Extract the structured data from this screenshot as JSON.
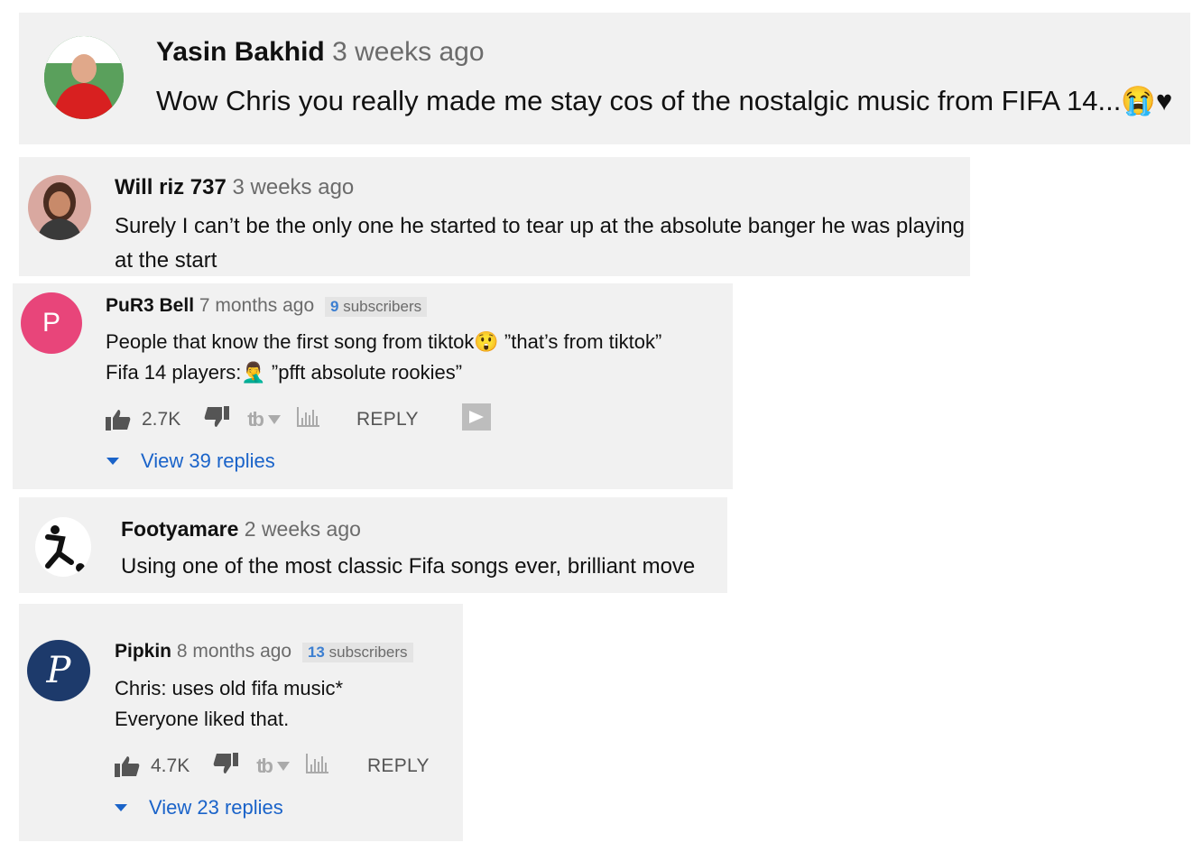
{
  "comments": [
    {
      "author": "Yasin Bakhid",
      "time": "3 weeks ago",
      "lines": [
        "Wow Chris you really made me stay cos of the nostalgic music from FIFA 14...😭♥"
      ]
    },
    {
      "author": "Will riz 737",
      "time": "3 weeks ago",
      "lines": [
        "Surely I can’t be the only one he started to tear up at the absolute banger he was playing",
        "at the start"
      ]
    },
    {
      "author": "PuR3 Bell",
      "time": "7 months ago",
      "subs_count": "9",
      "subs_label": "subscribers",
      "avatar_letter": "P",
      "lines": [
        "People that know the first song from tiktok😲 ”that’s from tiktok”",
        "Fifa 14 players:🤦‍♂️ ”pfft absolute rookies”"
      ],
      "likes": "2.7K",
      "reply_label": "REPLY",
      "view_replies": "View 39 replies"
    },
    {
      "author": "Footyamare",
      "time": "2 weeks ago",
      "lines": [
        "Using one of the most classic Fifa songs ever, brilliant move"
      ]
    },
    {
      "author": "Pipkin",
      "time": "8 months ago",
      "subs_count": "13",
      "subs_label": "subscribers",
      "avatar_letter": "P",
      "lines": [
        "Chris: uses old fifa music*",
        "Everyone liked that."
      ],
      "likes": "4.7K",
      "reply_label": "REPLY",
      "view_replies": "View 23 replies"
    }
  ],
  "colors": {
    "card_bg": "#f1f1f1",
    "link_blue": "#1a63c9",
    "pur3_avatar": "#e8457a",
    "pipkin_avatar": "#1d3a6b"
  }
}
